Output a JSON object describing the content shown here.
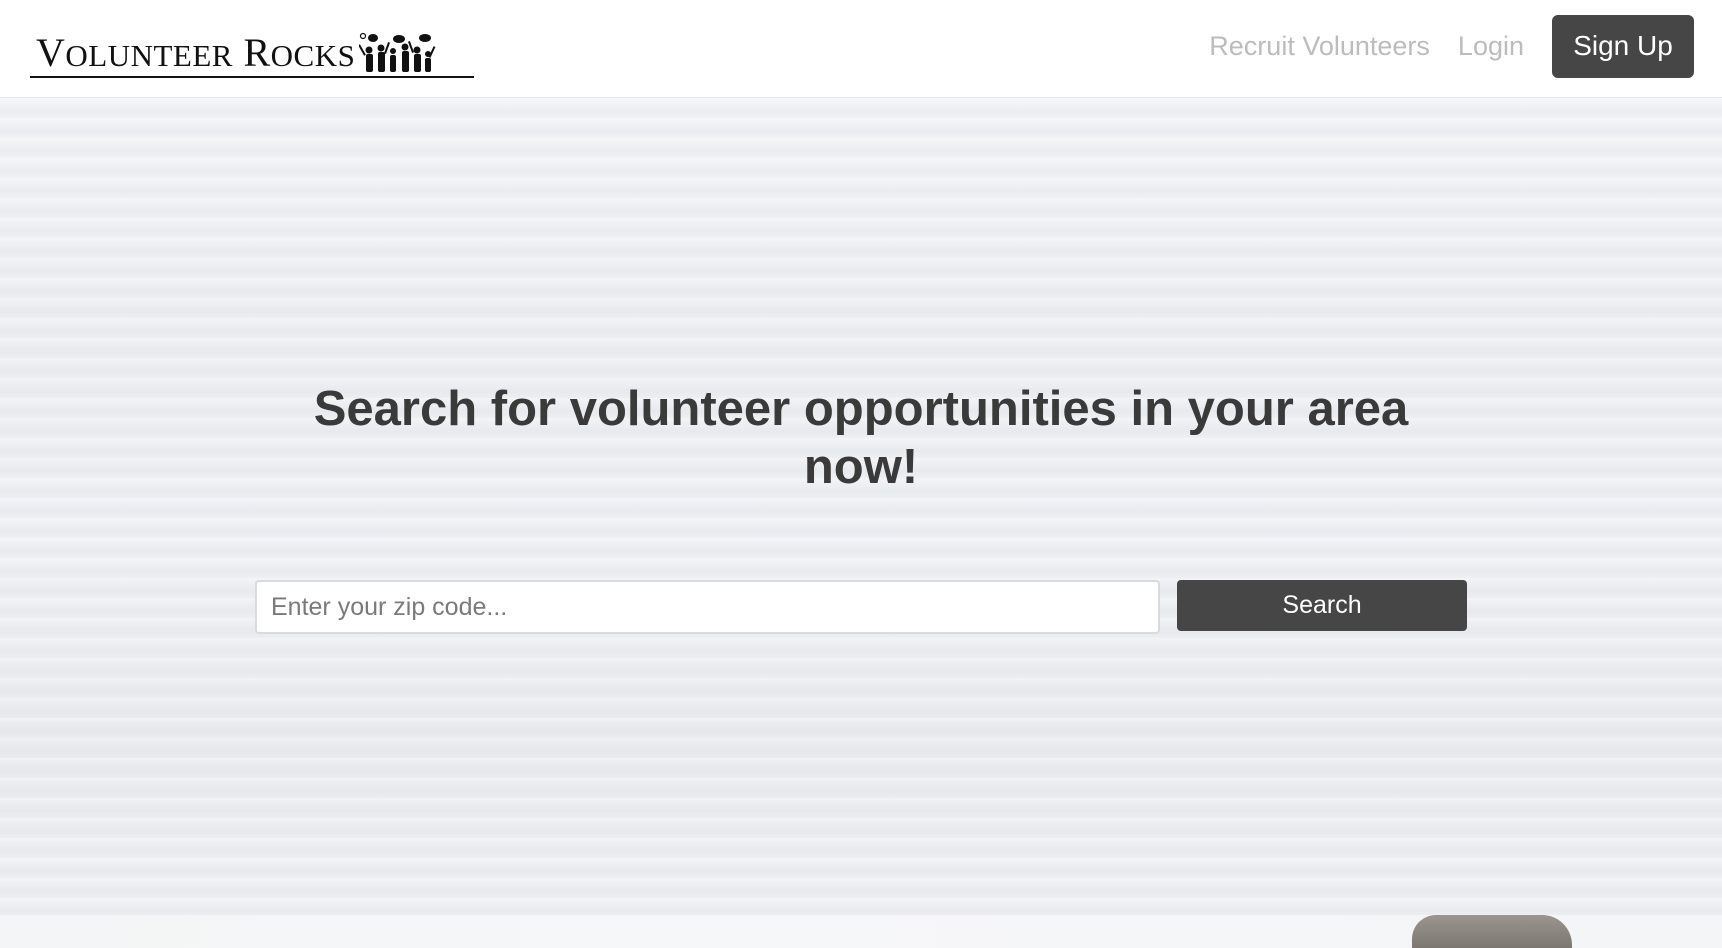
{
  "header": {
    "logo": {
      "text_main": "VOLUNTEER ROCKS",
      "icon": "volunteers-silhouette-icon"
    },
    "nav": {
      "recruit_label": "Recruit Volunteers",
      "login_label": "Login",
      "signup_label": "Sign Up"
    }
  },
  "hero": {
    "title": "Search for volunteer opportunities in your area now!",
    "search": {
      "placeholder": "Enter your zip code...",
      "value": "",
      "button_label": "Search"
    }
  },
  "colors": {
    "primary_button": "#464646",
    "nav_link": "#bcbcbc",
    "heading": "#3a3a3a"
  }
}
